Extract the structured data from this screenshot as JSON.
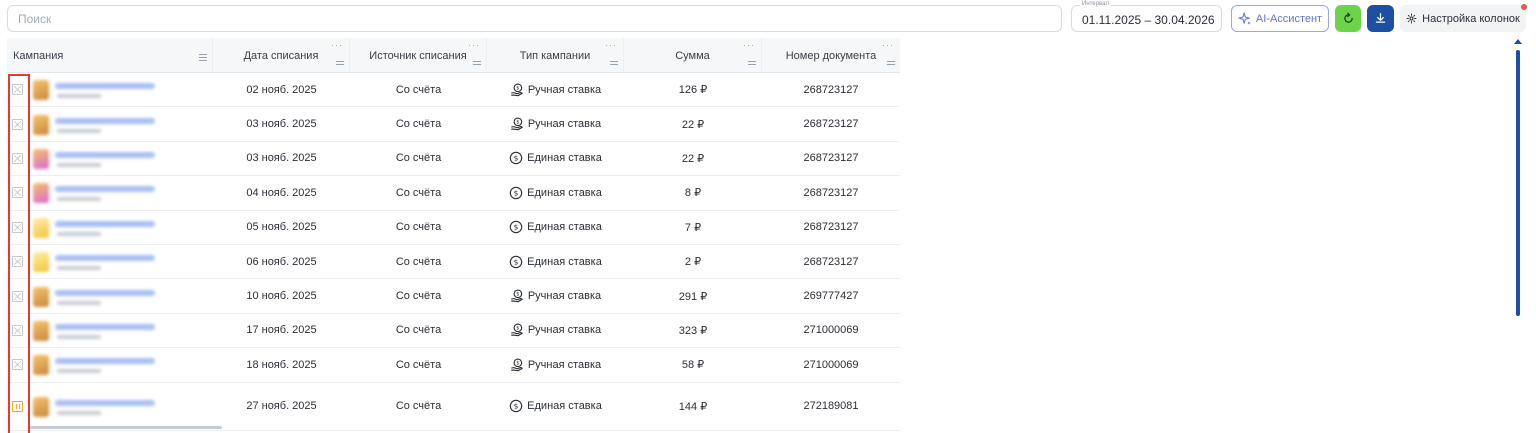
{
  "search": {
    "placeholder": "Поиск"
  },
  "interval": {
    "label": "Интервал",
    "value": "01.11.2025 – 30.04.2026"
  },
  "toolbar": {
    "ai_label": "AI-Ассистент",
    "columns_label": "Настройка колонок",
    "refresh_color": "#6dd34a",
    "download_color": "#1d4fa5"
  },
  "table": {
    "headers": {
      "campaign": "Кампания",
      "date": "Дата списания",
      "source": "Источник списания",
      "type": "Тип кампании",
      "amount": "Сумма",
      "doc": "Номер документа"
    },
    "rows": [
      {
        "status": "stopped",
        "date": "02 нояб. 2025",
        "source": "Со счёта",
        "type": "Ручная ставка",
        "type_icon": "hand-coin-icon",
        "amount": "126 ₽",
        "doc": "268723127"
      },
      {
        "status": "stopped",
        "date": "03 нояб. 2025",
        "source": "Со счёта",
        "type": "Ручная ставка",
        "type_icon": "hand-coin-icon",
        "amount": "22 ₽",
        "doc": "268723127"
      },
      {
        "status": "stopped",
        "date": "03 нояб. 2025",
        "source": "Со счёта",
        "type": "Единая ставка",
        "type_icon": "dollar-circle-icon",
        "amount": "22 ₽",
        "doc": "268723127"
      },
      {
        "status": "stopped",
        "date": "04 нояб. 2025",
        "source": "Со счёта",
        "type": "Единая ставка",
        "type_icon": "dollar-circle-icon",
        "amount": "8 ₽",
        "doc": "268723127"
      },
      {
        "status": "stopped",
        "date": "05 нояб. 2025",
        "source": "Со счёта",
        "type": "Единая ставка",
        "type_icon": "dollar-circle-icon",
        "amount": "7 ₽",
        "doc": "268723127"
      },
      {
        "status": "stopped",
        "date": "06 нояб. 2025",
        "source": "Со счёта",
        "type": "Единая ставка",
        "type_icon": "dollar-circle-icon",
        "amount": "2 ₽",
        "doc": "268723127"
      },
      {
        "status": "stopped",
        "date": "10 нояб. 2025",
        "source": "Со счёта",
        "type": "Ручная ставка",
        "type_icon": "hand-coin-icon",
        "amount": "291 ₽",
        "doc": "269777427"
      },
      {
        "status": "stopped",
        "date": "17 нояб. 2025",
        "source": "Со счёта",
        "type": "Ручная ставка",
        "type_icon": "hand-coin-icon",
        "amount": "323 ₽",
        "doc": "271000069"
      },
      {
        "status": "stopped",
        "date": "18 нояб. 2025",
        "source": "Со счёта",
        "type": "Ручная ставка",
        "type_icon": "hand-coin-icon",
        "amount": "58 ₽",
        "doc": "271000069"
      },
      {
        "status": "paused",
        "date": "27 нояб. 2025",
        "source": "Со счёта",
        "type": "Единая ставка",
        "type_icon": "dollar-circle-icon",
        "amount": "144 ₽",
        "doc": "272189081"
      }
    ]
  },
  "colors": {
    "accent": "#1d4fa5",
    "highlight_frame": "#e53935",
    "paused": "#f0a72a"
  }
}
